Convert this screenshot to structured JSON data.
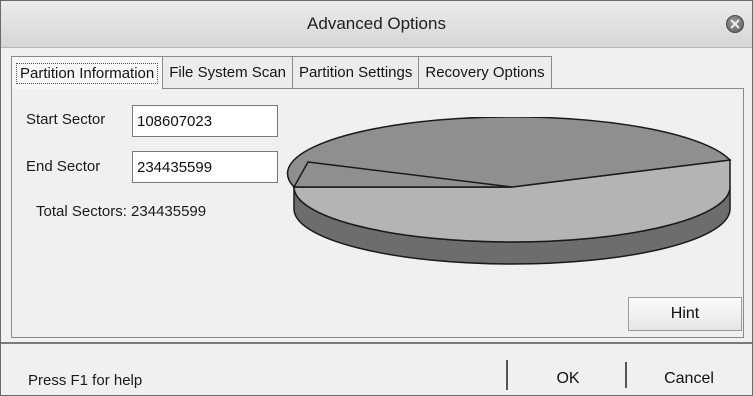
{
  "window": {
    "title": "Advanced Options"
  },
  "tabs": [
    {
      "label": "Partition Information",
      "active": true
    },
    {
      "label": "File System Scan",
      "active": false
    },
    {
      "label": "Partition Settings",
      "active": false
    },
    {
      "label": "Recovery Options",
      "active": false
    }
  ],
  "partition_info": {
    "start_sector_label": "Start Sector",
    "start_sector_value": "108607023",
    "end_sector_label": "End Sector",
    "end_sector_value": "234435599",
    "total_sectors_text": "Total Sectors: 234435599"
  },
  "pie_chart": {
    "colors": {
      "dark_slice": "#8f8f8f",
      "light_slice": "#b4b4b4",
      "side": "#6d6d6d",
      "outline": "#1a1a1a"
    }
  },
  "buttons": {
    "hint": "Hint",
    "ok": "OK",
    "cancel": "Cancel"
  },
  "status": {
    "help_text": "Press F1 for help"
  },
  "icons": {
    "close": "close-icon"
  }
}
